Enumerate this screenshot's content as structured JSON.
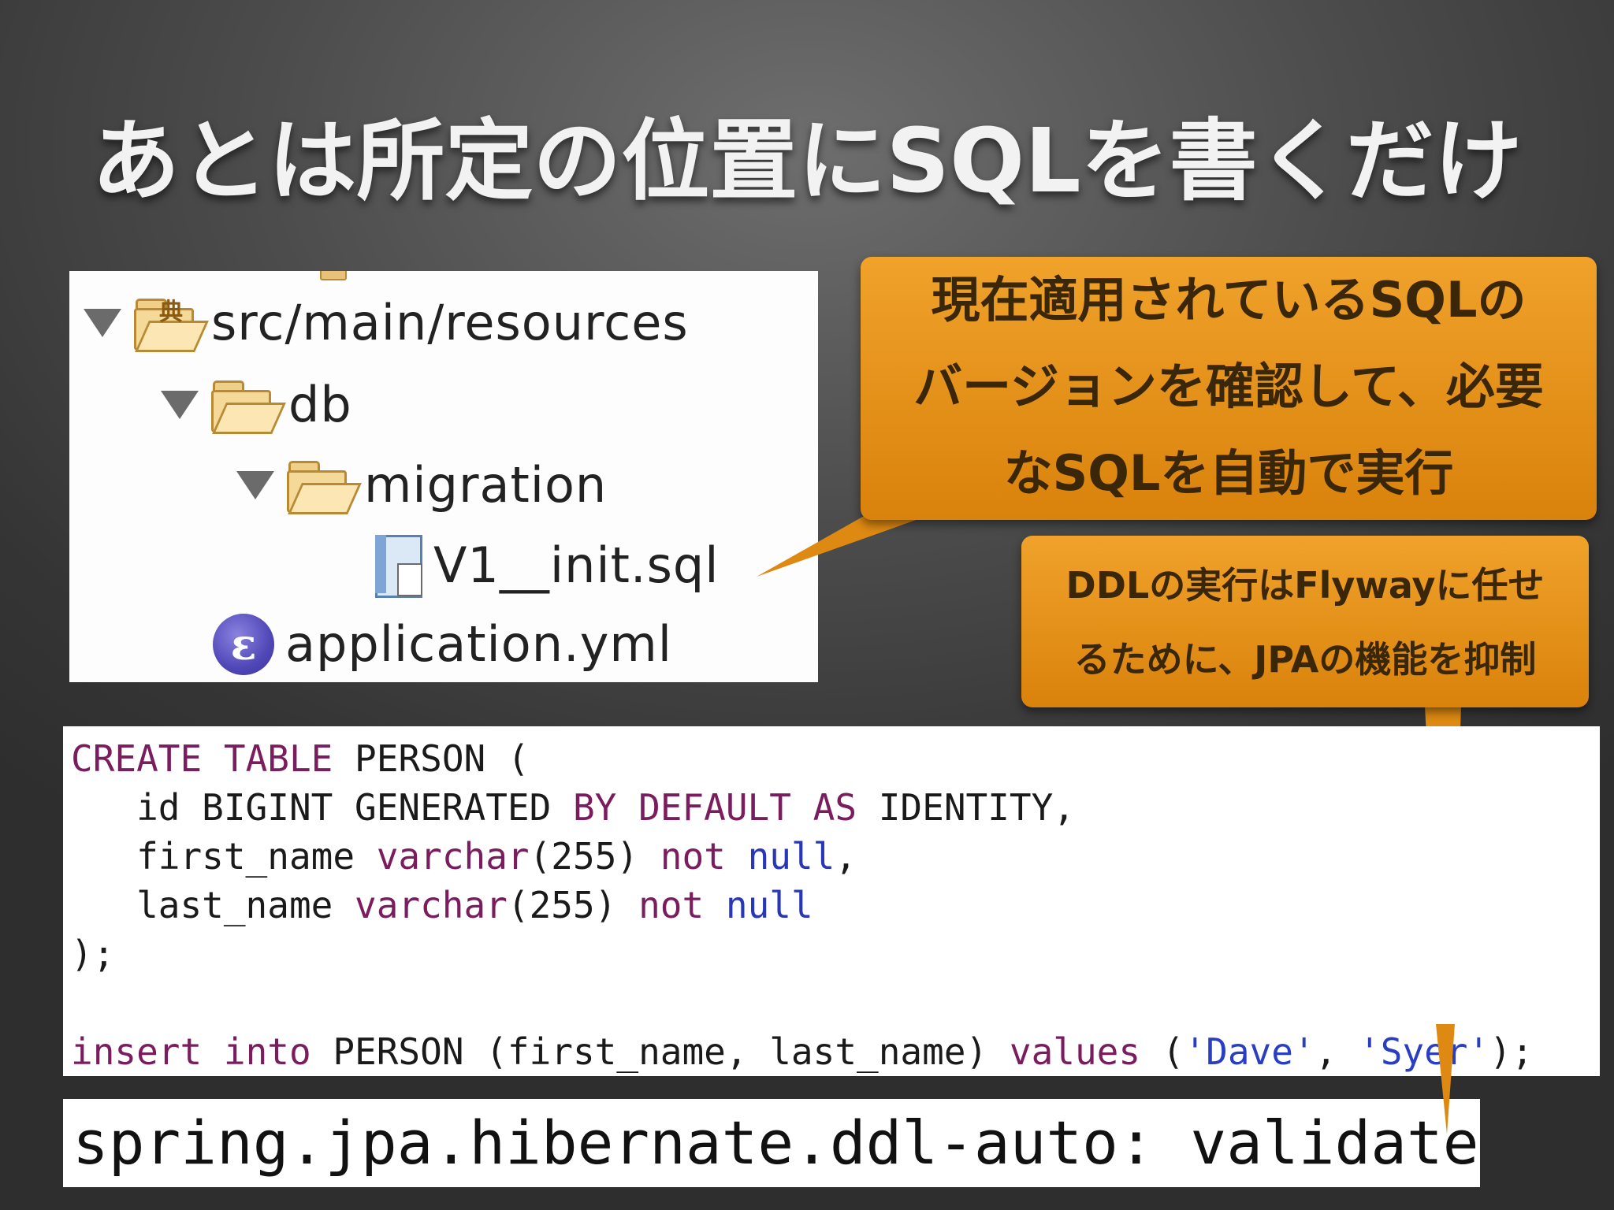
{
  "title": "あとは所定の位置にSQLを書くだけ",
  "tree": {
    "items": [
      {
        "label": "src/main/resources"
      },
      {
        "label": "db"
      },
      {
        "label": "migration"
      },
      {
        "label": "V1__init.sql"
      },
      {
        "label": "application.yml"
      }
    ],
    "icons": [
      "package-folder-icon",
      "folder-icon",
      "folder-icon",
      "sql-file-icon",
      "yaml-file-icon"
    ]
  },
  "callouts": {
    "migration_note": {
      "lines": [
        "現在適用されているSQLの",
        "バージョンを確認して、必要",
        "なSQLを自動で実行"
      ]
    },
    "ddl_note": {
      "lines": [
        "DDLの実行はFlywayに任せ",
        "るために、JPAの機能を抑制"
      ]
    },
    "color": "#e8931a"
  },
  "code": {
    "lines": [
      [
        {
          "t": "CREATE",
          "k": "kw"
        },
        {
          "t": " "
        },
        {
          "t": "TABLE",
          "k": "kw"
        },
        {
          "t": " PERSON ("
        }
      ],
      [
        {
          "t": "   id BIGINT GENERATED "
        },
        {
          "t": "BY",
          "k": "kw"
        },
        {
          "t": " "
        },
        {
          "t": "DEFAULT",
          "k": "kw"
        },
        {
          "t": " "
        },
        {
          "t": "AS",
          "k": "kw"
        },
        {
          "t": " IDENTITY,"
        }
      ],
      [
        {
          "t": "   first_name "
        },
        {
          "t": "varchar",
          "k": "kw"
        },
        {
          "t": "(255) "
        },
        {
          "t": "not",
          "k": "kw"
        },
        {
          "t": " "
        },
        {
          "t": "null",
          "k": "bl"
        },
        {
          "t": ","
        }
      ],
      [
        {
          "t": "   last_name "
        },
        {
          "t": "varchar",
          "k": "kw"
        },
        {
          "t": "(255) "
        },
        {
          "t": "not",
          "k": "kw"
        },
        {
          "t": " "
        },
        {
          "t": "null",
          "k": "bl"
        }
      ],
      [
        {
          "t": ");"
        }
      ],
      [
        {
          "t": ""
        }
      ],
      [
        {
          "t": "insert",
          "k": "kw"
        },
        {
          "t": " "
        },
        {
          "t": "into",
          "k": "kw"
        },
        {
          "t": " PERSON (first_name, last_name) "
        },
        {
          "t": "values",
          "k": "kw"
        },
        {
          "t": " ("
        },
        {
          "t": "'Dave'",
          "k": "str"
        },
        {
          "t": ", "
        },
        {
          "t": "'Syer'",
          "k": "str"
        },
        {
          "t": ");"
        }
      ]
    ]
  },
  "config_line": "spring.jpa.hibernate.ddl-auto: validate"
}
